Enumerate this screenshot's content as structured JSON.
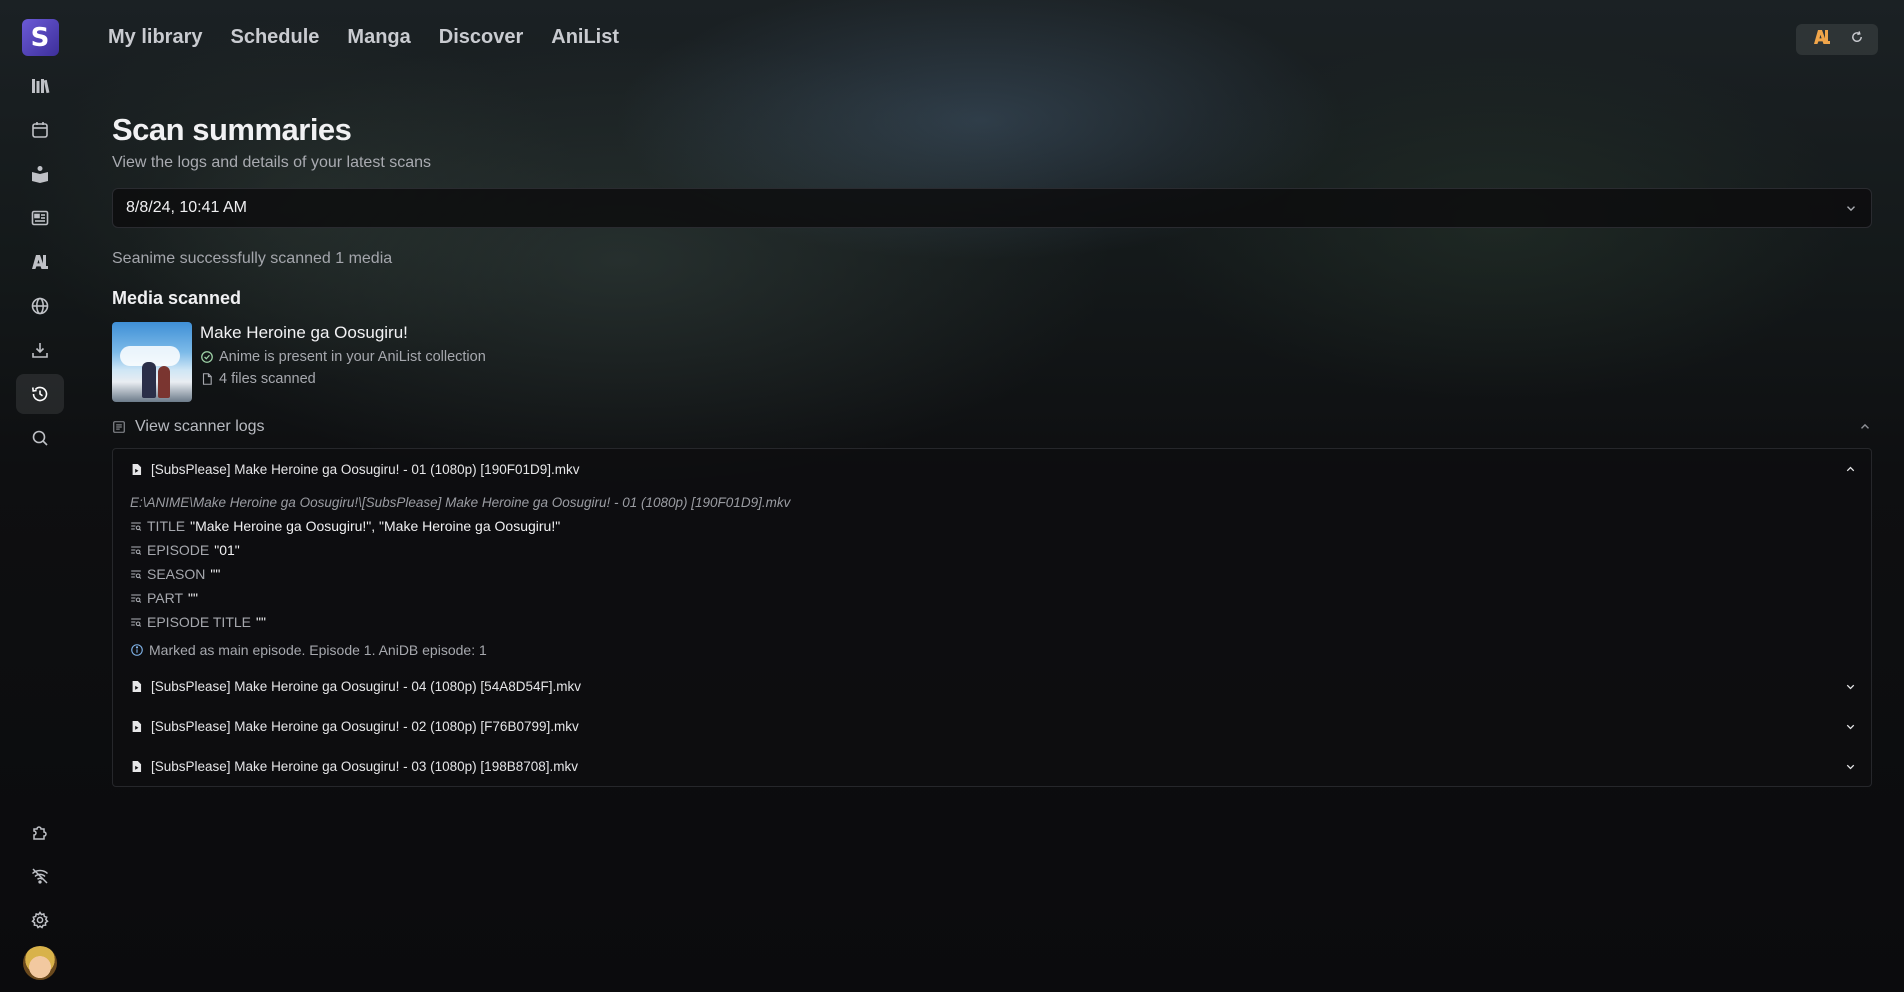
{
  "app": {
    "logo_letter": "S"
  },
  "sidebar": {
    "items": [
      {
        "icon": "library-icon",
        "active": false
      },
      {
        "icon": "calendar-icon",
        "active": false
      },
      {
        "icon": "book-icon",
        "active": false
      },
      {
        "icon": "news-icon",
        "active": false
      },
      {
        "icon": "anilist-icon",
        "active": false
      },
      {
        "icon": "globe-icon",
        "active": false
      },
      {
        "icon": "download-icon",
        "active": false
      },
      {
        "icon": "history-icon",
        "active": true
      },
      {
        "icon": "search-icon",
        "active": false
      }
    ],
    "bottom_items": [
      "puzzle-icon",
      "wifi-off-icon",
      "gear-icon",
      "avatar"
    ]
  },
  "topnav": {
    "items": [
      "My library",
      "Schedule",
      "Manga",
      "Discover",
      "AniList"
    ]
  },
  "topright": {
    "badge": "AL"
  },
  "page": {
    "title": "Scan summaries",
    "subtitle": "View the logs and details of your latest scans",
    "selected_scan": "8/8/24, 10:41 AM",
    "summary": "Seanime successfully scanned 1 media",
    "media_heading": "Media scanned"
  },
  "media": {
    "title": "Make Heroine ga Oosugiru!",
    "status": "Anime is present in your AniList collection",
    "files": "4 files scanned"
  },
  "logs": {
    "toggle_label": "View scanner logs",
    "files": [
      {
        "name": "[SubsPlease] Make Heroine ga Oosugiru! - 01 (1080p) [190F01D9].mkv",
        "expanded": true,
        "path": "E:\\ANIME\\Make Heroine ga Oosugiru!\\[SubsPlease] Make Heroine ga Oosugiru! - 01 (1080p) [190F01D9].mkv",
        "fields": [
          {
            "key": "TITLE",
            "value": "\"Make Heroine ga Oosugiru!\", \"Make Heroine ga Oosugiru!\""
          },
          {
            "key": "EPISODE",
            "value": "\"01\""
          },
          {
            "key": "SEASON",
            "value": "\"\""
          },
          {
            "key": "PART",
            "value": "\"\""
          },
          {
            "key": "EPISODE TITLE",
            "value": "\"\""
          }
        ],
        "info": "Marked as main episode. Episode 1. AniDB episode: 1"
      },
      {
        "name": "[SubsPlease] Make Heroine ga Oosugiru! - 04 (1080p) [54A8D54F].mkv",
        "expanded": false
      },
      {
        "name": "[SubsPlease] Make Heroine ga Oosugiru! - 02 (1080p) [F76B0799].mkv",
        "expanded": false
      },
      {
        "name": "[SubsPlease] Make Heroine ga Oosugiru! - 03 (1080p) [198B8708].mkv",
        "expanded": false
      }
    ]
  }
}
